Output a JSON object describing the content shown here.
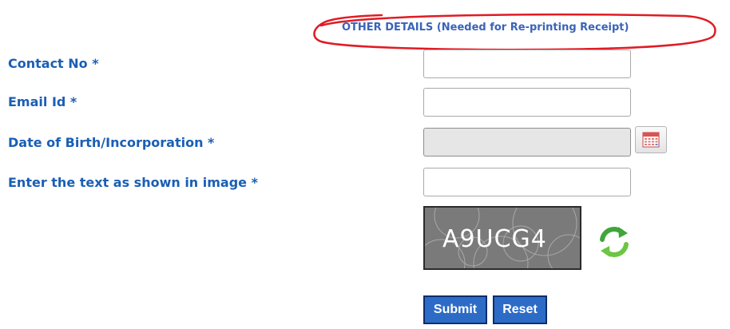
{
  "section": {
    "title": "OTHER DETAILS (Needed for Re-printing Receipt)"
  },
  "fields": {
    "contact_label": "Contact No *",
    "contact_value": "",
    "email_label": "Email Id *",
    "email_value": "",
    "dob_label": "Date of Birth/Incorporation *",
    "dob_value": "",
    "captcha_label": "Enter the text as shown in image *",
    "captcha_value": ""
  },
  "captcha": {
    "text": "A9UCG4"
  },
  "buttons": {
    "submit": "Submit",
    "reset": "Reset"
  },
  "colors": {
    "label": "#1a5fb4",
    "title": "#3a63b8",
    "annotation": "#e01b24",
    "button": "#2d6cc6"
  },
  "icons": {
    "calendar": "calendar-icon",
    "refresh": "refresh-icon"
  }
}
